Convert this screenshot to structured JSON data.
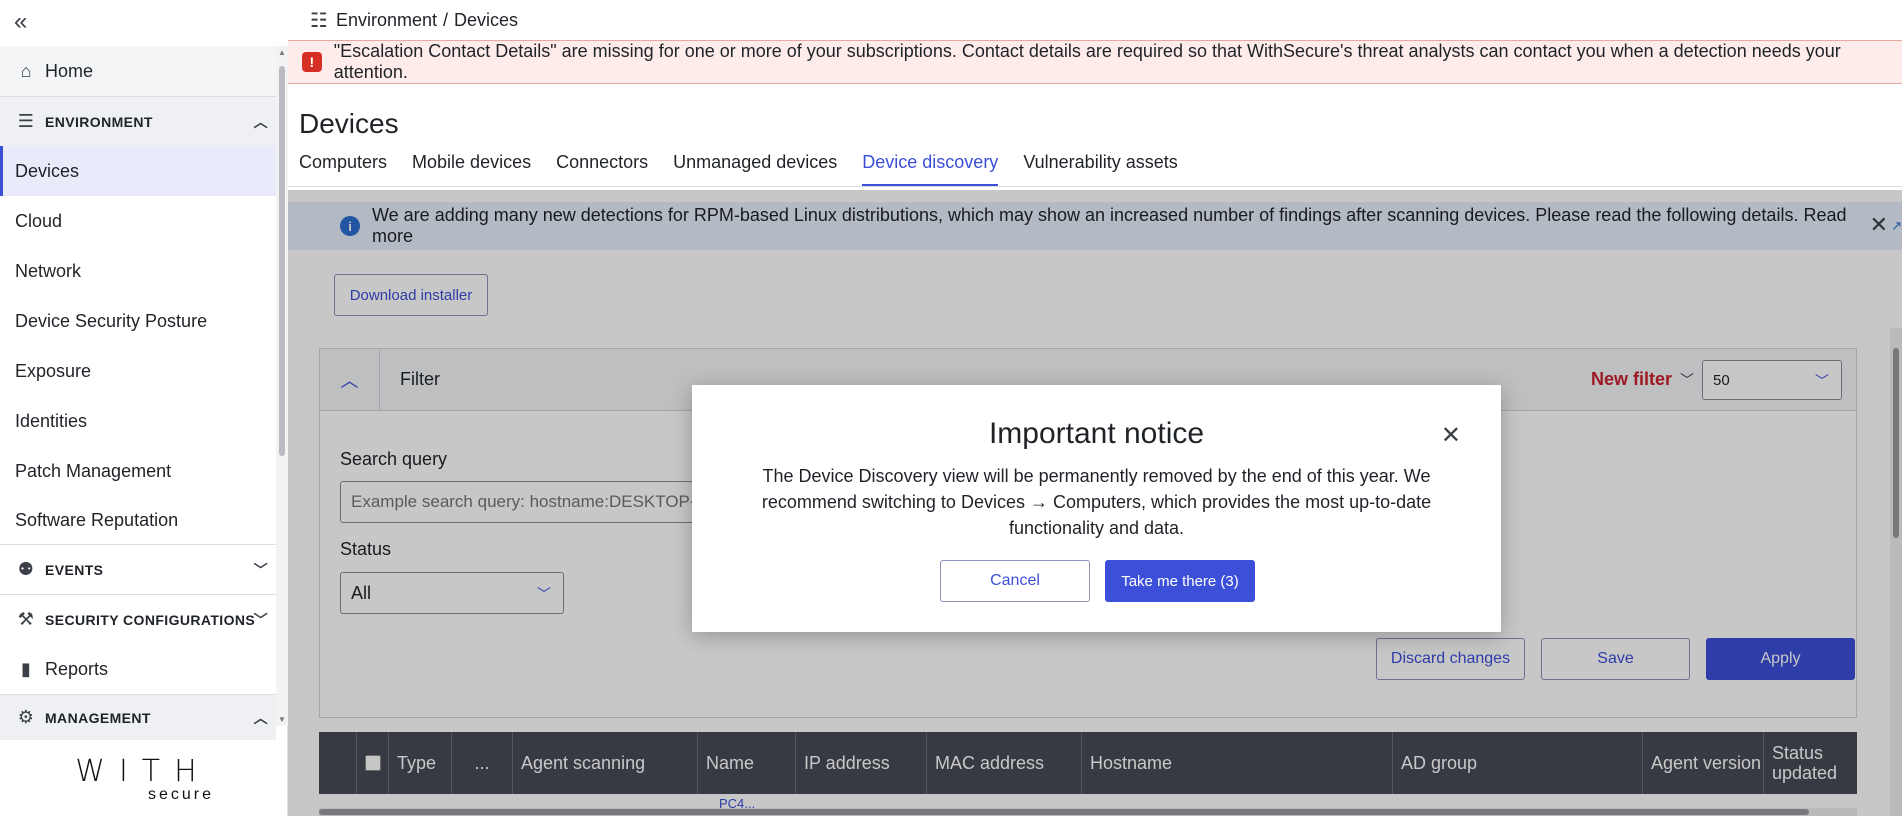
{
  "sidebar": {
    "collapse_glyph": "«",
    "home": "Home",
    "environment_section": "ENVIRONMENT",
    "environment_items": [
      "Devices",
      "Cloud",
      "Network",
      "Device Security Posture",
      "Exposure",
      "Identities",
      "Patch Management",
      "Software Reputation"
    ],
    "events_section": "EVENTS",
    "security_section": "SECURITY CONFIGURATIONS",
    "reports": "Reports",
    "management_section": "MANAGEMENT",
    "logo_top": "WITH",
    "logo_bottom": "secure"
  },
  "breadcrumb": {
    "part1": "Environment",
    "separator": "/",
    "part2": "Devices"
  },
  "alert": {
    "text": "\"Escalation Contact Details\" are missing for one or more of your subscriptions. Contact details are required so that WithSecure's threat analysts can contact you when a detection needs your attention."
  },
  "page": {
    "title": "Devices",
    "tabs": [
      "Computers",
      "Mobile devices",
      "Connectors",
      "Unmanaged devices",
      "Device discovery",
      "Vulnerability assets"
    ],
    "active_tab": "Device discovery"
  },
  "info_bar": {
    "text": "We are adding many new detections for RPM-based Linux distributions, which may show an increased number of findings after scanning devices. Please read the following details. Read more"
  },
  "toolbar": {
    "download_installer": "Download installer"
  },
  "filter": {
    "label": "Filter",
    "new_filter": "New filter",
    "page_size": "50",
    "search_label": "Search query",
    "search_placeholder": "Example search query: hostname:DESKTOP-v...",
    "status_label": "Status",
    "status_value": "All",
    "discard": "Discard changes",
    "save": "Save",
    "apply": "Apply"
  },
  "table": {
    "columns": [
      "Type",
      "...",
      "Agent scanning",
      "Name",
      "IP address",
      "MAC address",
      "Hostname",
      "AD group",
      "Agent version",
      "Status updated"
    ],
    "first_row_name_partial": "PC4..."
  },
  "modal": {
    "title": "Important notice",
    "body": "The Device Discovery view will be permanently removed by the end of this year. We recommend switching to Devices → Computers, which provides the most up-to-date functionality and data.",
    "cancel": "Cancel",
    "confirm": "Take me there (3)"
  },
  "colors": {
    "accent": "#3b4fd8",
    "danger": "#c8202d",
    "alert_bg": "#fdecea",
    "info_bg": "#e6effa",
    "table_header": "#474b55"
  }
}
